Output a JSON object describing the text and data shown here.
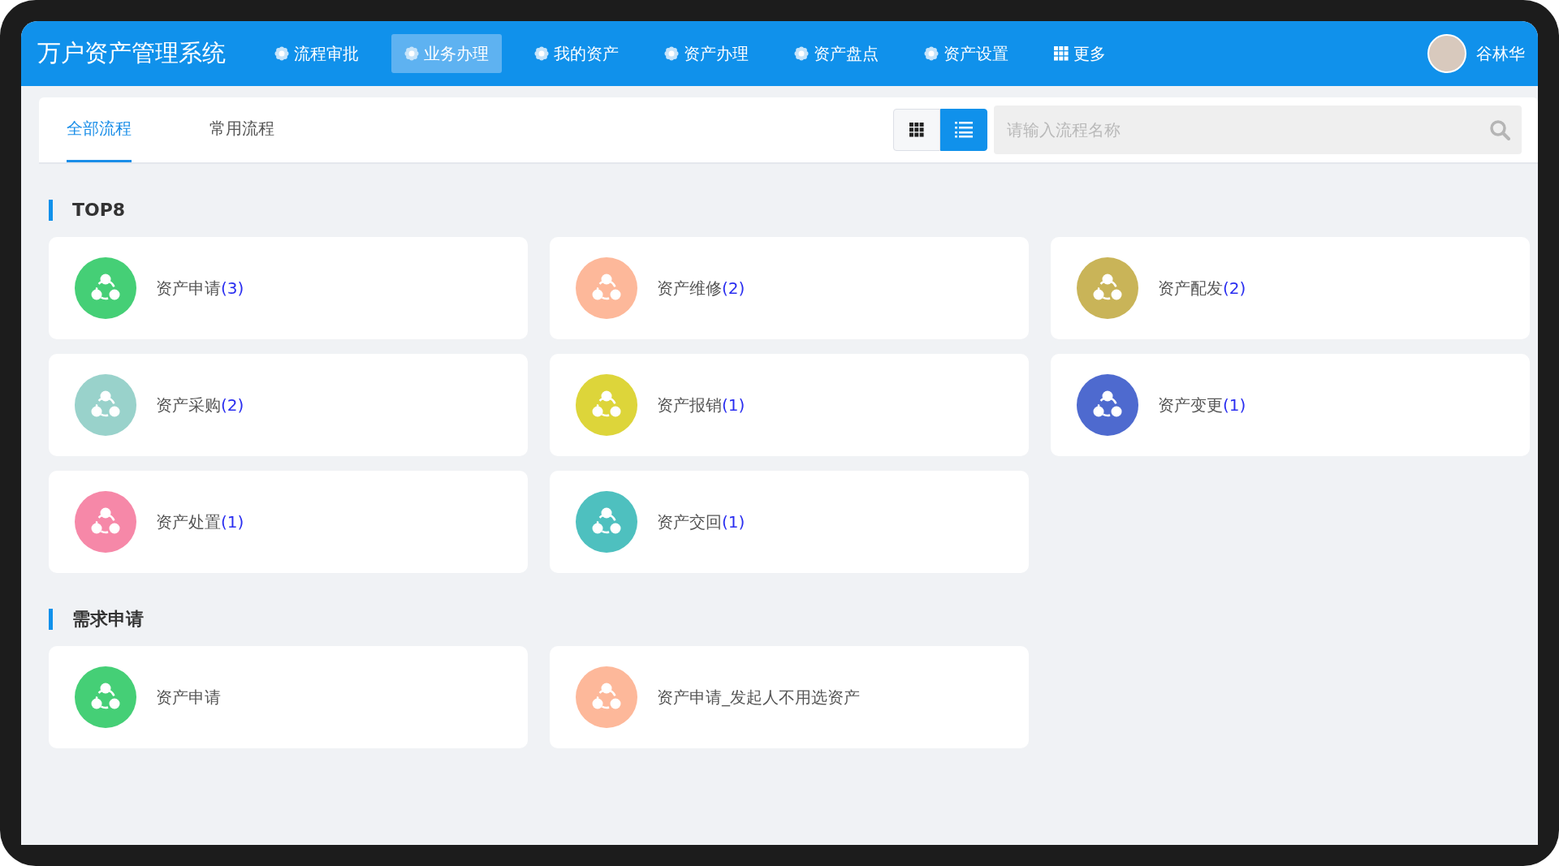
{
  "app_title": "万户资产管理系统",
  "nav": [
    {
      "label": "流程审批",
      "kind": "flower",
      "selected": false
    },
    {
      "label": "业务办理",
      "kind": "flower",
      "selected": true
    },
    {
      "label": "我的资产",
      "kind": "flower",
      "selected": false
    },
    {
      "label": "资产办理",
      "kind": "flower",
      "selected": false
    },
    {
      "label": "资产盘点",
      "kind": "flower",
      "selected": false
    },
    {
      "label": "资产设置",
      "kind": "flower",
      "selected": false
    },
    {
      "label": "更多",
      "kind": "grid",
      "selected": false
    }
  ],
  "user": {
    "name": "谷林华"
  },
  "tabs": [
    {
      "label": "全部流程",
      "selected": true
    },
    {
      "label": "常用流程",
      "selected": false
    }
  ],
  "view_toggle": [
    {
      "kind": "grid",
      "selected": false
    },
    {
      "kind": "list",
      "selected": true
    }
  ],
  "search": {
    "placeholder": "请输入流程名称"
  },
  "sections": [
    {
      "title": "TOP8",
      "items": [
        {
          "name": "资产申请",
          "count": "(3)",
          "color": "#45cf76"
        },
        {
          "name": "资产维修",
          "count": "(2)",
          "color": "#fdb89a"
        },
        {
          "name": "资产配发",
          "count": "(2)",
          "color": "#c9b458"
        },
        {
          "name": "资产采购",
          "count": "(2)",
          "color": "#99d2cb"
        },
        {
          "name": "资产报销",
          "count": "(1)",
          "color": "#ddd53a"
        },
        {
          "name": "资产变更",
          "count": "(1)",
          "color": "#4e6acf"
        },
        {
          "name": "资产处置",
          "count": "(1)",
          "color": "#f688a8"
        },
        {
          "name": "资产交回",
          "count": "(1)",
          "color": "#4ec0bf"
        }
      ]
    },
    {
      "title": "需求申请",
      "items": [
        {
          "name": "资产申请",
          "color": "#45cf76"
        },
        {
          "name": "资产申请_发起人不用选资产",
          "color": "#fdb89a"
        }
      ]
    }
  ]
}
